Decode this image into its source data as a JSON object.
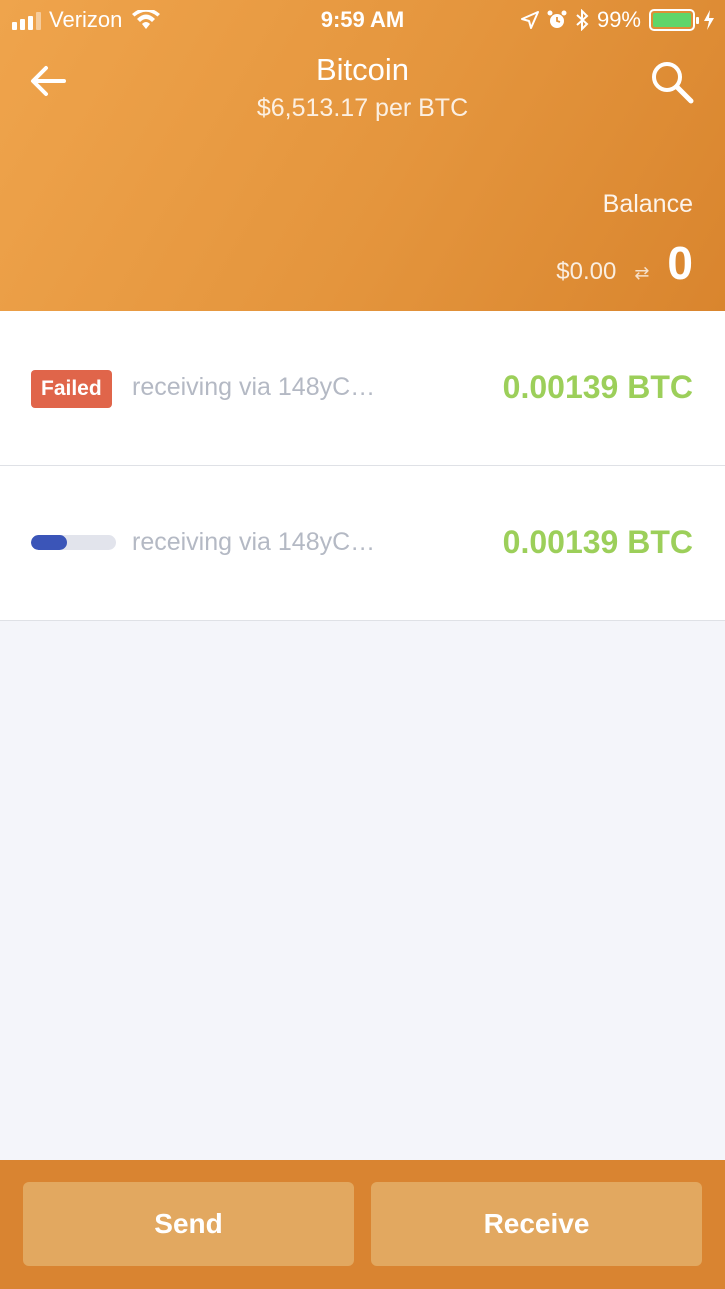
{
  "status_bar": {
    "carrier": "Verizon",
    "time": "9:59 AM",
    "battery": "99%",
    "battery_level": 0.99,
    "icons": [
      "signal-icon",
      "wifi-icon",
      "location-icon",
      "alarm-icon",
      "bluetooth-icon",
      "battery-icon",
      "charging-icon"
    ]
  },
  "header": {
    "title": "Bitcoin",
    "subtitle": "$6,513.17 per BTC",
    "back_icon": "back-arrow-icon",
    "search_icon": "search-icon",
    "balance_label": "Balance",
    "balance_usd": "$0.00",
    "swap_icon": "⇄",
    "balance_btc": "0",
    "color": "#e4953d"
  },
  "transactions": [
    {
      "status": "Failed",
      "description": "receiving via 148yC…",
      "amount": "0.00139 BTC"
    },
    {
      "status_progress": 0.42,
      "description": "receiving via 148yC…",
      "amount": "0.00139 BTC"
    }
  ],
  "footer": {
    "send_label": "Send",
    "receive_label": "Receive"
  },
  "colors": {
    "accent_orange": "#e4953d",
    "amount_green": "#9ccf5a",
    "failed_red": "#e0654a",
    "progress_blue": "#3b55b8"
  }
}
